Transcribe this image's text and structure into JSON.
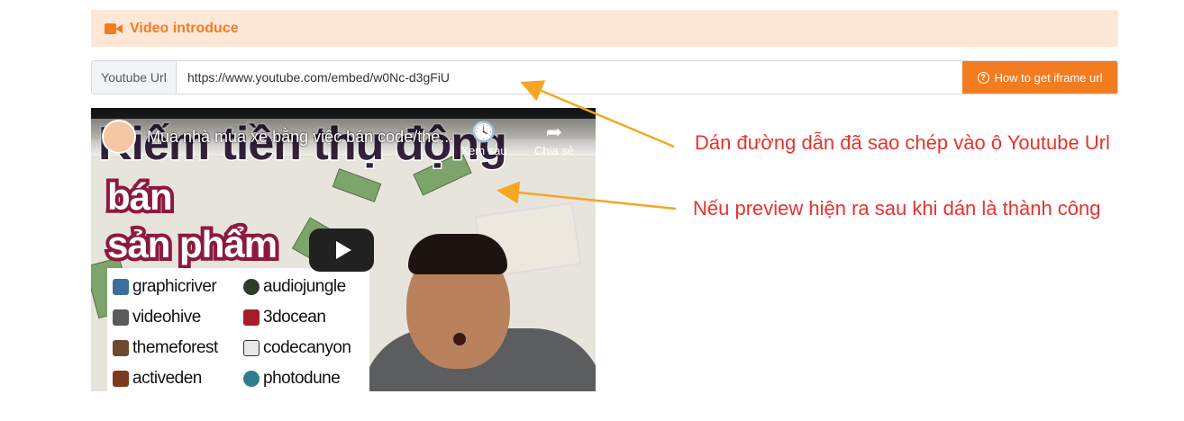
{
  "section": {
    "icon": "video-camera-icon",
    "title": "Video introduce",
    "accent_color": "#f47c20",
    "background_color": "#fde8d8"
  },
  "url_field": {
    "label": "Youtube Url",
    "value": "https://www.youtube.com/embed/w0Nc-d3gFiU",
    "help_button_label": "How to get iframe url",
    "help_button_icon": "question-circle-icon"
  },
  "video": {
    "title": "Mua nhà mua xe bằng việc bán code/the...",
    "watch_later_label": "Xem sau",
    "share_label": "Chia sẻ",
    "overlay_headline": "Kiếm tiền thụ động",
    "overlay_line1": "bán",
    "overlay_line2": "sản phẩm",
    "brands": [
      "graphicriver",
      "audiojungle",
      "videohive",
      "3docean",
      "themeforest",
      "codecanyon",
      "activeden",
      "photodune"
    ]
  },
  "annotations": {
    "paste_hint": "Dán đường dẫn đã sao chép vào ô Youtube Url",
    "preview_hint": "Nếu preview hiện ra sau khi dán là thành công",
    "text_color": "#e8322d",
    "arrow_color": "#f5a623"
  }
}
